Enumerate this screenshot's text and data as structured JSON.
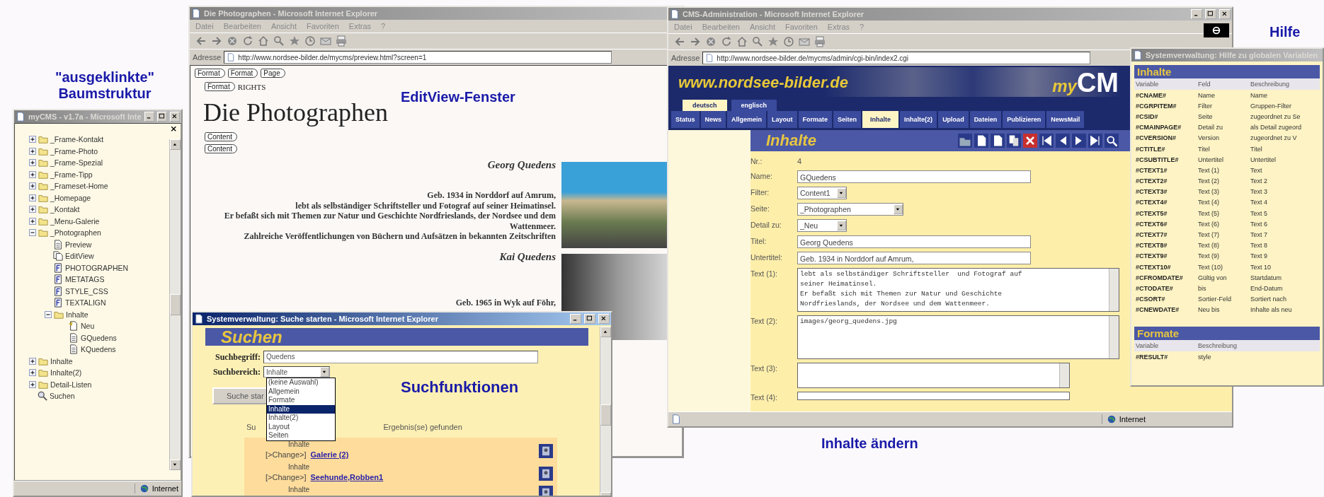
{
  "annotations": [
    {
      "text": "\"ausgeklinkte\" Baumstruktur"
    },
    {
      "text": "EditView-Fenster"
    },
    {
      "text": "Suchfunktionen"
    },
    {
      "text": "Inhalte ändern"
    },
    {
      "text": "Hilfe"
    }
  ],
  "tree_window": {
    "title": "myCMS - v1.7a - Microsoft Inte",
    "active": false,
    "status": "Internet",
    "tree": [
      {
        "label": "_Frame-Kontakt",
        "kind": "folder",
        "expanded": false
      },
      {
        "label": "_Frame-Photo",
        "kind": "folder",
        "expanded": false
      },
      {
        "label": "_Frame-Spezial",
        "kind": "folder",
        "expanded": false
      },
      {
        "label": "_Frame-Tipp",
        "kind": "folder",
        "expanded": false
      },
      {
        "label": "_Frameset-Home",
        "kind": "folder",
        "expanded": false
      },
      {
        "label": "_Homepage",
        "kind": "folder",
        "expanded": false
      },
      {
        "label": "_Kontakt",
        "kind": "folder",
        "expanded": false
      },
      {
        "label": "_Menu-Galerie",
        "kind": "folder",
        "expanded": false
      },
      {
        "label": "_Photographen",
        "kind": "folder",
        "expanded": true,
        "children": [
          {
            "label": "Preview",
            "kind": "page"
          },
          {
            "label": "EditView",
            "kind": "pages"
          },
          {
            "label": "PHOTOGRAPHEN",
            "kind": "format"
          },
          {
            "label": "METATAGS",
            "kind": "format"
          },
          {
            "label": "STYLE_CSS",
            "kind": "format"
          },
          {
            "label": "TEXTALIGN",
            "kind": "format"
          },
          {
            "label": "Inhalte",
            "kind": "folder",
            "expanded": true,
            "children": [
              {
                "label": "Neu",
                "kind": "new"
              },
              {
                "label": "GQuedens",
                "kind": "page"
              },
              {
                "label": "KQuedens",
                "kind": "page"
              }
            ]
          }
        ]
      },
      {
        "label": "Inhalte",
        "kind": "folder",
        "expanded": false
      },
      {
        "label": "Inhalte(2)",
        "kind": "folder",
        "expanded": false
      },
      {
        "label": "Detail-Listen",
        "kind": "folder",
        "expanded": false
      },
      {
        "label": "Suchen",
        "kind": "search"
      }
    ]
  },
  "editview_window": {
    "title": "Die Photographen - Microsoft Internet Explorer",
    "active": false,
    "menu": [
      "Datei",
      "Bearbeiten",
      "Ansicht",
      "Favoriten",
      "Extras",
      "?"
    ],
    "address_label": "Adresse",
    "address": "http://www.nordsee-bilder.de/mycms/preview.html?screen=1",
    "tags": [
      "Format",
      "Format",
      "Page"
    ],
    "format_tag": "Format",
    "format_value": "RIGHTS",
    "heading": "Die Photographen",
    "content_tags": [
      "Content",
      "Content"
    ],
    "persons": [
      {
        "name": "Georg Quedens",
        "lines": [
          "Geb. 1934 in Norddorf auf Amrum,",
          "lebt als selbständiger Schriftsteller und Fotograf auf seiner Heimatinsel.",
          "Er befaßt sich mit Themen zur Natur und Geschichte Nordfrieslands, der Nordsee und dem Wattenmeer.",
          "Zahlreiche Veröffentlichungen von Büchern und Aufsätzen in bekannten Zeitschriften"
        ]
      },
      {
        "name": "Kai Quedens",
        "lines": [
          "Geb. 1965 in Wyk auf Föhr,"
        ]
      }
    ]
  },
  "search_window": {
    "title": "Systemverwaltung: Suche starten - Microsoft Internet Explorer",
    "active": true,
    "header": "Suchen",
    "term_label": "Suchbegriff:",
    "term_value": "Quedens",
    "area_label": "Suchbereich:",
    "area_value": "Inhalte",
    "area_options": [
      {
        "label": "(keine Auswahl)",
        "selected": false
      },
      {
        "label": "Allgemein",
        "selected": false
      },
      {
        "label": "Formate",
        "selected": false
      },
      {
        "label": "Inhalte",
        "selected": true
      },
      {
        "label": "Inhalte(2)",
        "selected": false
      },
      {
        "label": "Layout",
        "selected": false
      },
      {
        "label": "Seiten",
        "selected": false
      }
    ],
    "button": "Suche star",
    "result_prefix": "Su",
    "result_suffix": "Ergebnis(se) gefunden",
    "results": [
      {
        "area": "Inhalte",
        "action": "[>Change>]",
        "link": "Galerie (2)"
      },
      {
        "area": "Inhalte",
        "action": "[>Change>]",
        "link": "Seehunde,Robben1"
      },
      {
        "area": "Inhalte"
      }
    ]
  },
  "cms_window": {
    "title": "CMS-Administration - Microsoft Internet Explorer",
    "active": false,
    "menu": [
      "Datei",
      "Bearbeiten",
      "Ansicht",
      "Favoriten",
      "Extras",
      "?"
    ],
    "address_label": "Adresse",
    "address": "http://www.nordsee-bilder.de/mycms/admin/cgi-bin/index2.cgi",
    "site": "www.nordsee-bilder.de",
    "logo_prefix": "my",
    "logo_main": "CM",
    "languages": [
      {
        "label": "deutsch",
        "selected": true
      },
      {
        "label": "englisch",
        "selected": false
      }
    ],
    "nav": [
      {
        "label": "Status",
        "selected": false
      },
      {
        "label": "News",
        "selected": false
      },
      {
        "label": "Allgemein",
        "selected": false
      },
      {
        "label": "Layout",
        "selected": false
      },
      {
        "label": "Formate",
        "selected": false
      },
      {
        "label": "Seiten",
        "selected": false
      },
      {
        "label": "Inhalte",
        "selected": true
      },
      {
        "label": "Inhalte(2)",
        "selected": false
      },
      {
        "label": "Upload",
        "selected": false
      },
      {
        "label": "Dateien",
        "selected": false
      },
      {
        "label": "Publizieren",
        "selected": false
      },
      {
        "label": "NewsMail",
        "selected": false
      }
    ],
    "panel_title": "Inhalte",
    "fields": [
      {
        "label": "Nr.:",
        "kind": "static",
        "value": "4"
      },
      {
        "label": "Name:",
        "kind": "text",
        "value": "GQuedens"
      },
      {
        "label": "Filter:",
        "kind": "select",
        "value": "Content1"
      },
      {
        "label": "Seite:",
        "kind": "select",
        "value": "_Photographen"
      },
      {
        "label": "Detail zu:",
        "kind": "select",
        "value": "_Neu"
      },
      {
        "label": "Titel:",
        "kind": "text",
        "value": "Georg Quedens"
      },
      {
        "label": "Untertitel:",
        "kind": "text",
        "value": "Geb. 1934 in Norddorf auf Amrum,"
      },
      {
        "label": "Text (1):",
        "kind": "textarea",
        "value": "lebt als selbständiger Schriftsteller  und Fotograf auf\nseiner Heimatinsel.\nEr befaßt sich mit Themen zur Natur und Geschichte\nNordfrieslands, der Nordsee und dem Wattenmeer."
      },
      {
        "label": "Text (2):",
        "kind": "textarea",
        "value": "images/georg_quedens.jpg"
      },
      {
        "label": "Text (3):",
        "kind": "smallarea"
      },
      {
        "label": "Text (4):",
        "kind": "cutarea"
      }
    ],
    "status": "Internet"
  },
  "help_window": {
    "title": "Systemverwaltung: Hilfe zu globalen Variablen",
    "active": false,
    "sections": [
      {
        "title": "Inhalte",
        "columns": [
          "Variable",
          "Feld",
          "Beschreibung"
        ],
        "rows": [
          [
            "#CNAME#",
            "Name",
            "Name"
          ],
          [
            "#CGRPITEM#",
            "Filter",
            "Gruppen-Filter"
          ],
          [
            "#CSID#",
            "Seite",
            "zugeordnet zu Se"
          ],
          [
            "#CMAINPAGE#",
            "Detail zu",
            "als Detail zugeord"
          ],
          [
            "#CVERSION#",
            "Version",
            "zugeordnet zu V"
          ],
          [
            "#CTITLE#",
            "Titel",
            "Titel"
          ],
          [
            "#CSUBTITLE#",
            "Untertitel",
            "Untertitel"
          ],
          [
            "#CTEXT1#",
            "Text (1)",
            "Text"
          ],
          [
            "#CTEXT2#",
            "Text (2)",
            "Text 2"
          ],
          [
            "#CTEXT3#",
            "Text (3)",
            "Text 3"
          ],
          [
            "#CTEXT4#",
            "Text (4)",
            "Text 4"
          ],
          [
            "#CTEXT5#",
            "Text (5)",
            "Text 5"
          ],
          [
            "#CTEXT6#",
            "Text (6)",
            "Text 6"
          ],
          [
            "#CTEXT7#",
            "Text (7)",
            "Text 7"
          ],
          [
            "#CTEXT8#",
            "Text (8)",
            "Text 8"
          ],
          [
            "#CTEXT9#",
            "Text (9)",
            "Text 9"
          ],
          [
            "#CTEXT10#",
            "Text (10)",
            "Text 10"
          ],
          [
            "#CFROMDATE#",
            "Gültig von",
            "Startdatum"
          ],
          [
            "#CTODATE#",
            "bis",
            "End-Datum"
          ],
          [
            "#CSORT#",
            "Sortier-Feld",
            "Sortiert nach"
          ],
          [
            "#CNEWDATE#",
            "Neu bis",
            "Inhalte als neu"
          ]
        ]
      },
      {
        "title": "Formate",
        "columns": [
          "Variable",
          "Beschreibung"
        ],
        "rows": [
          [
            "#RESULT#",
            "style"
          ]
        ]
      }
    ]
  }
}
